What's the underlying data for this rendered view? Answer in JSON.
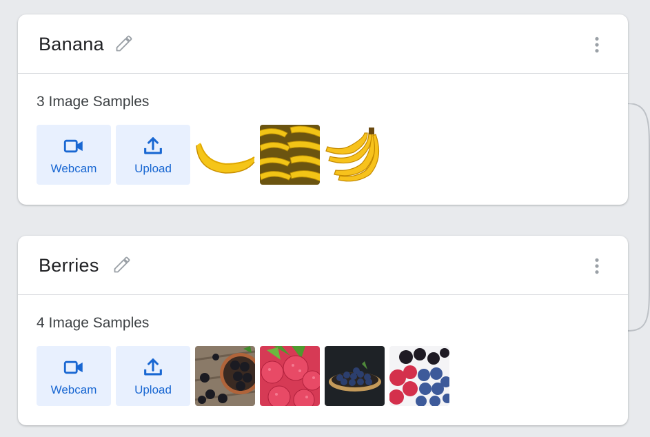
{
  "colors": {
    "page_bg": "#e8eaed",
    "card_bg": "#ffffff",
    "action_bg": "#e8f0fe",
    "accent": "#1967d2"
  },
  "classes": [
    {
      "name": "Banana",
      "samples_label": "3 Image Samples",
      "webcam_label": "Webcam",
      "upload_label": "Upload",
      "thumbnails": [
        "single-banana",
        "banana-bunch-pile",
        "banana-bunch"
      ]
    },
    {
      "name": "Berries",
      "samples_label": "4 Image Samples",
      "webcam_label": "Webcam",
      "upload_label": "Upload",
      "thumbnails": [
        "blackberries",
        "raspberries",
        "blueberries-bowl",
        "mixed-berries"
      ]
    }
  ],
  "icons": {
    "edit": "pencil-icon",
    "more": "more-vert-icon",
    "webcam": "videocam-icon",
    "upload": "upload-icon"
  }
}
